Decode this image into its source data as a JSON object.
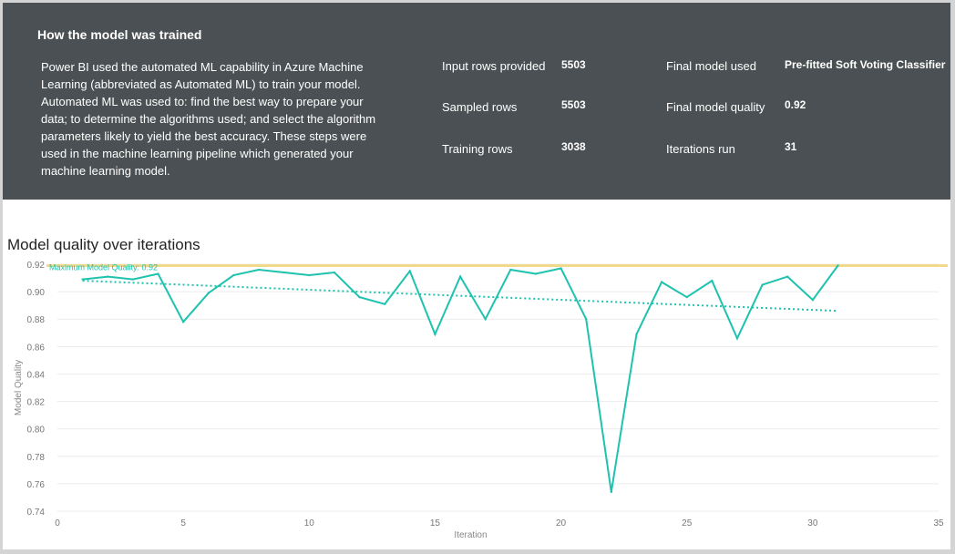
{
  "summary": {
    "title": "How the model was trained",
    "description": "Power BI used the automated ML capability in Azure Machine Learning (abbreviated as Automated ML) to train your model. Automated ML was used to: find the best way to prepare your data; to determine the algorithms used; and select the algorithm parameters likely to yield the best accuracy. These steps were used in the machine learning pipeline which generated your machine learning model.",
    "stats": {
      "input_rows_label": "Input rows provided",
      "input_rows_value": "5503",
      "sampled_rows_label": "Sampled rows",
      "sampled_rows_value": "5503",
      "training_rows_label": "Training rows",
      "training_rows_value": "3038",
      "final_model_label": "Final model used",
      "final_model_value": "Pre-fitted Soft Voting Classifier",
      "final_quality_label": "Final model quality",
      "final_quality_value": "0.92",
      "iterations_label": "Iterations run",
      "iterations_value": "31"
    }
  },
  "chart_data": {
    "type": "line",
    "title": "Model quality over iterations",
    "xlabel": "Iteration",
    "ylabel": "Model Quality",
    "xlim": [
      0,
      35
    ],
    "ylim": [
      0.74,
      0.92
    ],
    "xticks": [
      0,
      5,
      10,
      15,
      20,
      25,
      30,
      35
    ],
    "yticks": [
      0.74,
      0.76,
      0.78,
      0.8,
      0.82,
      0.84,
      0.86,
      0.88,
      0.9,
      0.92
    ],
    "grid": "horizontal",
    "x": [
      1,
      2,
      3,
      4,
      5,
      6,
      7,
      8,
      9,
      10,
      11,
      12,
      13,
      14,
      15,
      16,
      17,
      18,
      19,
      20,
      21,
      22,
      23,
      24,
      25,
      26,
      27,
      28,
      29,
      30,
      31
    ],
    "series": [
      {
        "values": [
          0.909,
          0.911,
          0.909,
          0.913,
          0.878,
          0.899,
          0.912,
          0.916,
          0.914,
          0.912,
          0.914,
          0.896,
          0.891,
          0.915,
          0.869,
          0.911,
          0.88,
          0.916,
          0.913,
          0.917,
          0.88,
          0.754,
          0.869,
          0.907,
          0.896,
          0.908,
          0.866,
          0.905,
          0.911,
          0.894,
          0.919
        ],
        "color": "#1fc2ae"
      }
    ],
    "trendline": {
      "x": [
        1,
        31
      ],
      "values": [
        0.908,
        0.886
      ],
      "color": "#1fc2ae",
      "style": "dotted"
    },
    "max_line": {
      "value": 0.919,
      "label": "Maximum Model Quality: 0.92",
      "color": "#f1d98c",
      "label_color": "#1fc2ae"
    }
  }
}
